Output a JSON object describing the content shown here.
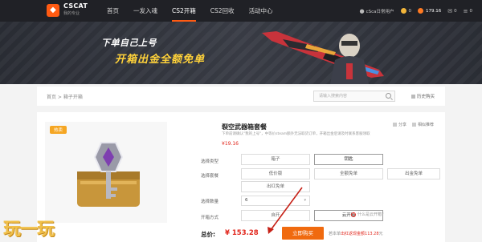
{
  "topbar": {
    "logo_text": "CSCAT",
    "logo_sub": "我的专业",
    "nav": [
      "首页",
      "一发入魂",
      "CS2开箱",
      "CS2回收",
      "活动中心"
    ],
    "active_nav": "CS2开箱",
    "user": {
      "name": "cSca日常用户",
      "coins": "0",
      "balance": "179.16",
      "messages": "0",
      "menu": "0"
    }
  },
  "banner": {
    "line1": "下单自己上号",
    "line2": "开箱出金全额免单"
  },
  "crumbbar": {
    "breadcrumb": "首页 > 箱子开箱",
    "search_placeholder": "请输入搜索内容",
    "recent_label": "历史购买"
  },
  "product": {
    "tag": "热卖",
    "title": "裂空武器箱套餐",
    "subtitle": "下单前请确认\"我的上号\"，中等价steam额外无法取货订单，开箱出金后请及时联系客服领取",
    "price": "¥19.16",
    "links": [
      "分享",
      "相似推荐"
    ],
    "rows": {
      "type_label": "选择类型",
      "type_options": [
        "箱子",
        "钥匙"
      ],
      "plan_label": "选择套餐",
      "plan_options": [
        "低价版",
        "全额免单",
        "出金免单",
        "出红免单"
      ],
      "qty_label": "选择数量",
      "qty_value": "6",
      "method_label": "开箱方式",
      "method_options": [
        "自开",
        "云开箱"
      ],
      "help_text": "什么是云开箱？"
    },
    "total_label": "总价:",
    "total_value": "¥ 153.28",
    "buy_label": "立即购买",
    "buy_note_prefix": "若本单",
    "buy_note_highlight": "出红返现金额113.28",
    "buy_note_suffix": "元"
  },
  "watermark": "玩一玩",
  "colors": {
    "accent": "#f06a0f",
    "price": "#e1251b",
    "topbar": "#202126",
    "banner_text": "#ffd23a"
  }
}
